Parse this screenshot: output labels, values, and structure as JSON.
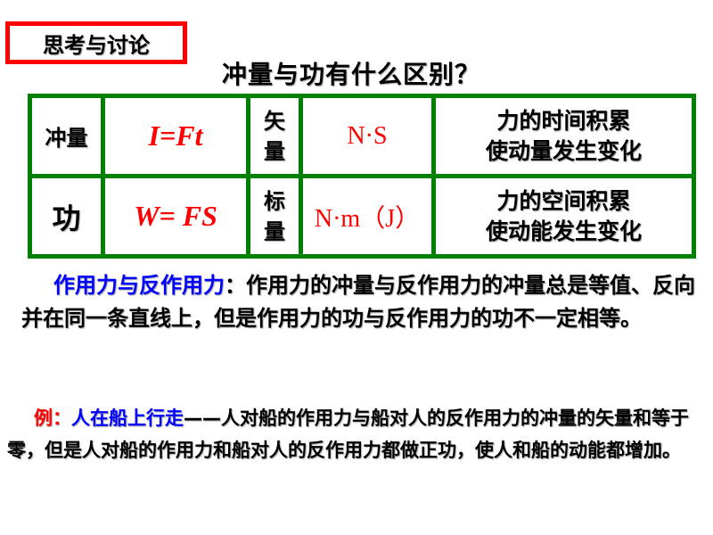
{
  "tag": {
    "label": "思考与讨论"
  },
  "title": "冲量与功有什么区别？",
  "table": {
    "rows": [
      {
        "name": "冲量",
        "formula": "I=Ft",
        "type": [
          "矢",
          "量"
        ],
        "unit": "N·S",
        "meaning": [
          "力的时间积累",
          "使动量发生变化"
        ]
      },
      {
        "name": "功",
        "formula": "W= FS",
        "type": [
          "标",
          "量"
        ],
        "unit": "N·m（J）",
        "meaning": [
          "力的空间积累",
          "使动能发生变化"
        ]
      }
    ]
  },
  "paragraph1": {
    "highlight": "作用力与反作用力",
    "text": "：作用力的冲量与反作用力的冲量总是等值、反向并在同一条直线上，但是作用力的功与反作用力的功不一定相等。"
  },
  "paragraph2": {
    "prefix": "例：",
    "highlight": "人在船上行走",
    "text": "——人对船的作用力与船对人的反作用力的冲量的矢量和等于零，但是人对船的作用力和船对人的反作用力都做正功，使人和船的动能都增加。"
  },
  "colors": {
    "border_red": "#ff0000",
    "table_green": "#008000",
    "formula_red": "#ff0000",
    "highlight_blue": "#0000ff"
  }
}
